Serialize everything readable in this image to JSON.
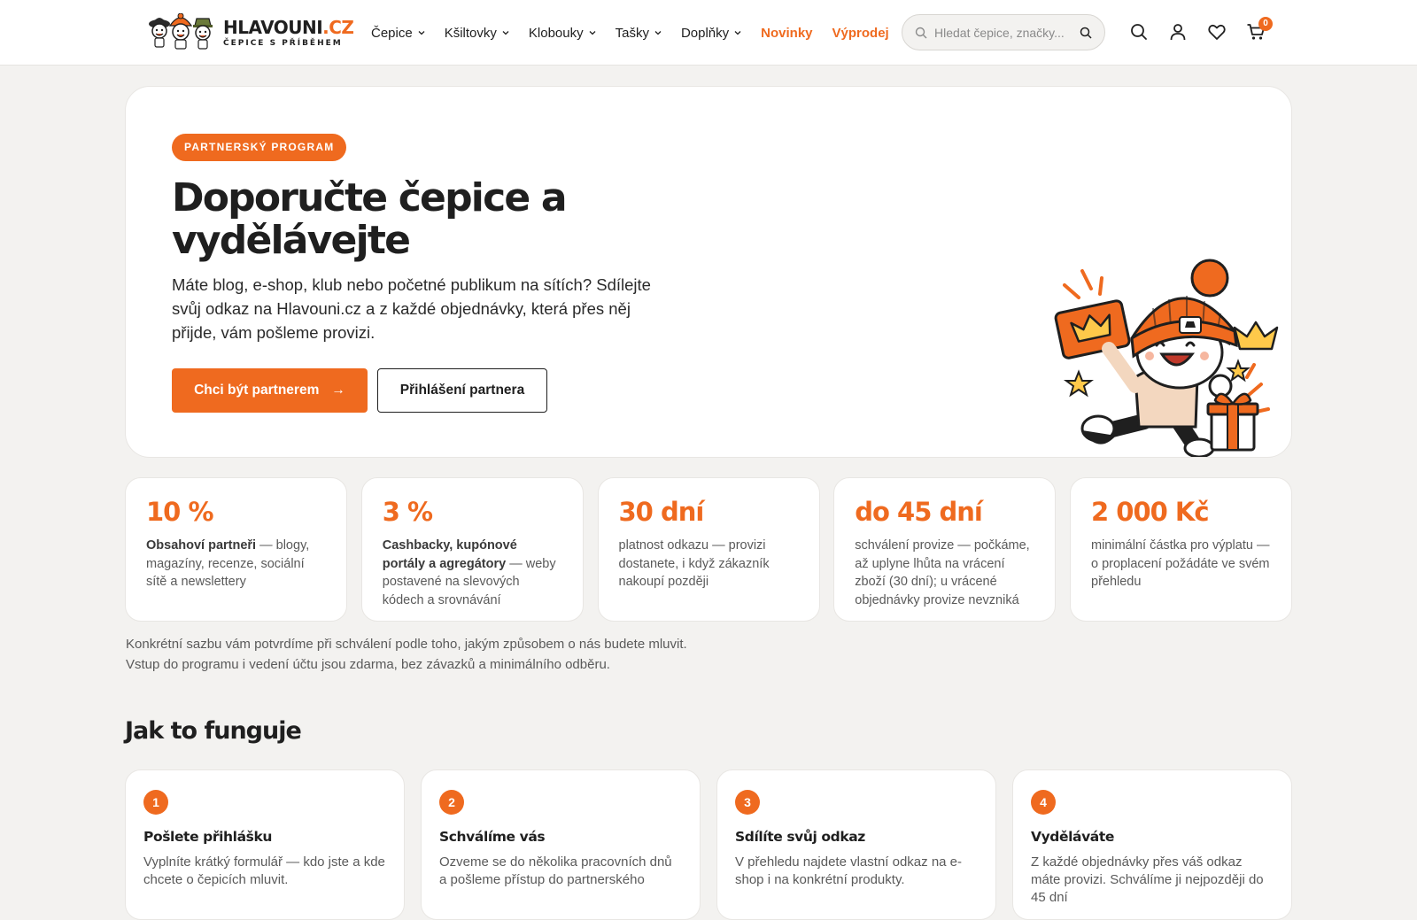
{
  "brand": {
    "name_main": "HLAVOUNI",
    "name_tld": ".CZ",
    "tagline": "ČEPICE S PŘÍBĚHEM",
    "accent_color": "#ef6a1f"
  },
  "nav": {
    "items": [
      {
        "label": "Čepice",
        "has_dropdown": true
      },
      {
        "label": "Kšiltovky",
        "has_dropdown": true
      },
      {
        "label": "Klobouky",
        "has_dropdown": true
      },
      {
        "label": "Tašky",
        "has_dropdown": true
      },
      {
        "label": "Doplňky",
        "has_dropdown": true
      }
    ],
    "highlight_items": [
      {
        "label": "Novinky"
      },
      {
        "label": "Výprodej"
      }
    ]
  },
  "search": {
    "placeholder": "Hledat čepice, značky..."
  },
  "header_icons": [
    "search-icon",
    "user-icon",
    "heart-icon",
    "cart-icon"
  ],
  "cart": {
    "count": "0"
  },
  "hero": {
    "badge": "PARTNERSKÝ PROGRAM",
    "title": "Doporučte čepice a vydělávejte",
    "text": "Máte blog, e-shop, klub nebo početné publikum na sítích? Sdílejte svůj odkaz na Hlavouni.cz a z každé objednávky, která přes něj přijde, vám pošleme provizi.",
    "primary_button": "Chci být partnerem",
    "primary_arrow": "→",
    "secondary_button": "Přihlášení partnera"
  },
  "stats": [
    {
      "value": "10 %",
      "strong": "Obsahoví partneři",
      "desc": " — blogy, magazíny, recenze, sociální sítě a newslettery"
    },
    {
      "value": "3 %",
      "strong": "Cashbacky, kupónové portály a agregátory",
      "desc": " — weby postavené na slevových kódech a srovnávání"
    },
    {
      "value": "30 dní",
      "strong": "",
      "desc": "platnost odkazu — provizi dostanete, i když zákazník nakoupí později"
    },
    {
      "value": "do 45 dní",
      "strong": "",
      "desc": "schválení provize — počkáme, až uplyne lhůta na vrácení zboží (30 dní); u vrácené objednávky provize nevzniká"
    },
    {
      "value": "2 000 Kč",
      "strong": "",
      "desc": "minimální částka pro výplatu — o proplacení požádáte ve svém přehledu"
    }
  ],
  "note": "Konkrétní sazbu vám potvrdíme při schválení podle toho, jakým způsobem o nás budete mluvit. Vstup do programu i vedení účtu jsou zdarma, bez závazků a minimálního odběru.",
  "how_it_works": {
    "title": "Jak to funguje",
    "steps": [
      {
        "num": "1",
        "title": "Pošlete přihlášku",
        "text": "Vyplníte krátký formulář — kdo jste a kde chcete o čepicích mluvit."
      },
      {
        "num": "2",
        "title": "Schválíme vás",
        "text": "Ozveme se do několika pracovních dnů a pošleme přístup do partnerského"
      },
      {
        "num": "3",
        "title": "Sdílíte svůj odkaz",
        "text": "V přehledu najdete vlastní odkaz na e-shop i na konkrétní produkty."
      },
      {
        "num": "4",
        "title": "Vyděláváte",
        "text": "Z každé objednávky přes váš odkaz máte provizi. Schválíme ji nejpozději do 45 dní"
      }
    ]
  }
}
